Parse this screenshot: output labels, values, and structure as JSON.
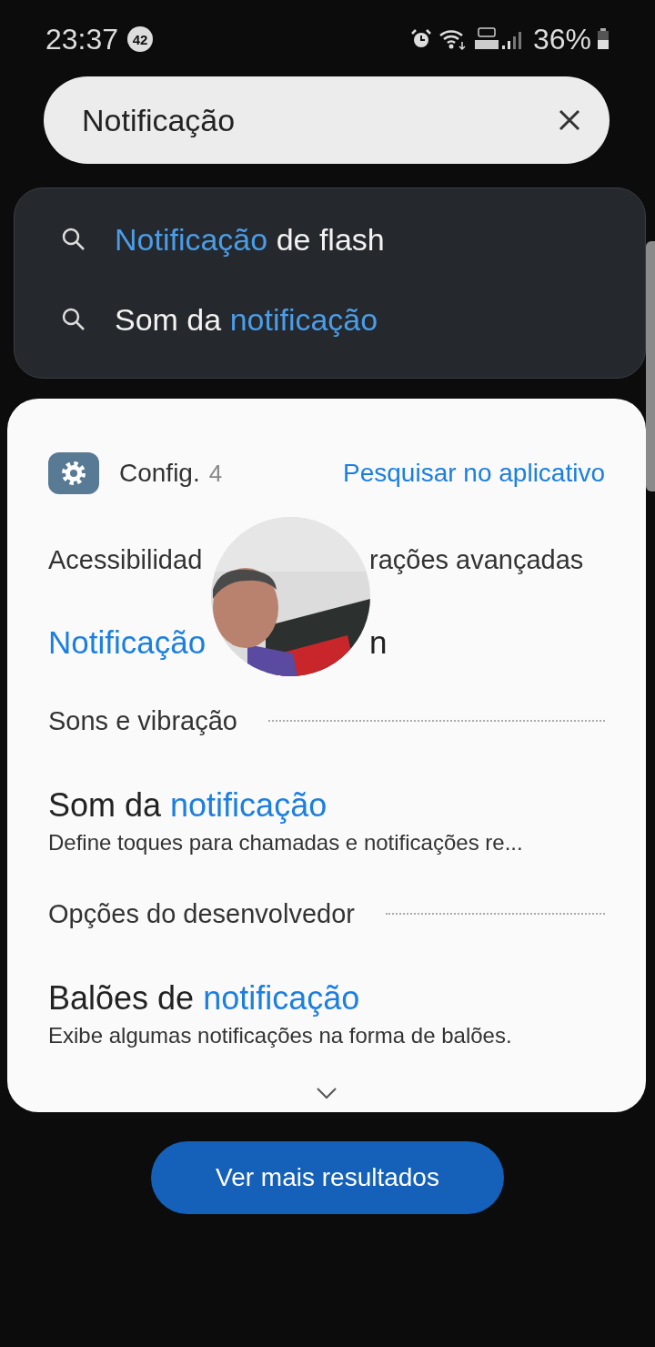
{
  "status_bar": {
    "time": "23:37",
    "notification_count": "42",
    "battery": "36%"
  },
  "search": {
    "value": "Notificação"
  },
  "suggestions": [
    {
      "parts": [
        {
          "text": "Notificação",
          "highlight": true
        },
        {
          "text": " de flash",
          "highlight": false
        }
      ]
    },
    {
      "parts": [
        {
          "text": "Som da ",
          "highlight": false
        },
        {
          "text": "notificação",
          "highlight": true
        }
      ]
    }
  ],
  "results_card": {
    "app_name": "Config.",
    "count": "4",
    "search_in_app": "Pesquisar no aplicativo",
    "results": [
      {
        "kind": "path-covered",
        "left": [
          {
            "text": "Acessibilidad",
            "highlight": false
          }
        ],
        "right": [
          {
            "text": "rações avançadas",
            "highlight": false
          }
        ]
      },
      {
        "kind": "title-covered",
        "left": [
          {
            "text": "Notificação",
            "highlight": true
          }
        ],
        "right": [
          {
            "text": "n",
            "highlight": false
          }
        ]
      },
      {
        "kind": "path",
        "text": "Sons e vibração"
      },
      {
        "kind": "title",
        "parts": [
          {
            "text": "Som da ",
            "highlight": false
          },
          {
            "text": "notificação",
            "highlight": true
          }
        ],
        "subtitle": "Define toques para chamadas e notificações re..."
      },
      {
        "kind": "path",
        "text": "Opções do desenvolvedor"
      },
      {
        "kind": "title",
        "parts": [
          {
            "text": "Balões de ",
            "highlight": false
          },
          {
            "text": "notificação",
            "highlight": true
          }
        ],
        "subtitle": "Exibe algumas notificações na forma de balões."
      }
    ]
  },
  "more_button": "Ver mais resultados"
}
